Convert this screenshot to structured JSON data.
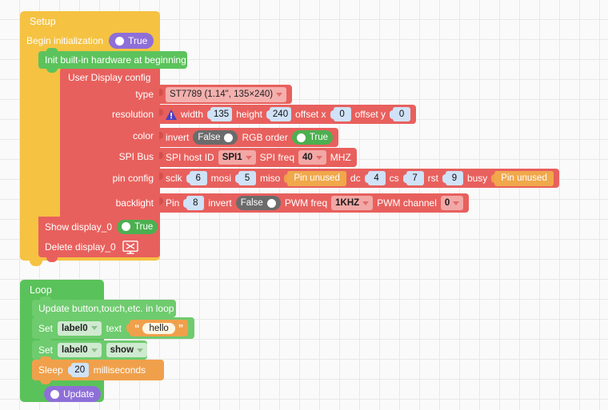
{
  "workspace": {
    "grid_size": 25,
    "background": "#fafafa",
    "grid_color": "#e8e8e8"
  },
  "colors": {
    "setup_hat": "#f5c242",
    "loop_hat": "#5ac25a",
    "statement_green": "#5cc35c",
    "config_red": "#e8605d",
    "value_orange": "#f0a04b",
    "boolean_purple": "#8e6fd8",
    "toggle_on": "#4caf50",
    "toggle_off": "#6b6b6b",
    "number_field": "#cfe2f7"
  },
  "setup": {
    "title": "Setup",
    "begin_init": {
      "label": "Begin initialization",
      "value": "True",
      "state": "on"
    },
    "init_hardware": {
      "label": "Init built-in hardware at beginning"
    },
    "display_config": {
      "title": "User Display config",
      "rows": [
        {
          "label": "type",
          "type_value": "ST7789 (1.14\", 135×240)"
        },
        {
          "label": "resolution",
          "warning": true,
          "width_label": "width",
          "width_value": "135",
          "height_label": "height",
          "height_value": "240",
          "offset_x_label": "offset x",
          "offset_x_value": "0",
          "offset_y_label": "offset y",
          "offset_y_value": "0"
        },
        {
          "label": "color",
          "invert_label": "invert",
          "invert_value": "False",
          "invert_state": "off",
          "rgb_label": "RGB order",
          "rgb_value": "True",
          "rgb_state": "on"
        },
        {
          "label": "SPI Bus",
          "host_label": "SPI host ID",
          "host_value": "SPI1",
          "freq_label": "SPI freq",
          "freq_value": "40",
          "freq_unit": "MHZ"
        },
        {
          "label": "pin config",
          "sclk_label": "sclk",
          "sclk_value": "6",
          "mosi_label": "mosi",
          "mosi_value": "5",
          "miso_label": "miso",
          "miso_value": "Pin unused",
          "dc_label": "dc",
          "dc_value": "4",
          "cs_label": "cs",
          "cs_value": "7",
          "rst_label": "rst",
          "rst_value": "9",
          "busy_label": "busy",
          "busy_value": "Pin unused"
        },
        {
          "label": "backlight",
          "pin_label": "Pin",
          "pin_value": "8",
          "invert_label": "invert",
          "invert_value": "False",
          "invert_state": "off",
          "pwm_freq_label": "PWM freq",
          "pwm_freq_value": "1KHZ",
          "pwm_channel_label": "PWM channel",
          "pwm_channel_value": "0"
        }
      ]
    },
    "show_display": {
      "label": "Show display_0",
      "value": "True",
      "state": "on"
    },
    "delete_display": {
      "label": "Delete display_0",
      "icon": "monitor-delete-icon"
    }
  },
  "loop": {
    "title": "Loop",
    "update_widgets": {
      "label": "Update button,touch,etc. in loop"
    },
    "set_text": {
      "set_label": "Set",
      "target": "label0",
      "property": "text",
      "string_value": "hello",
      "open_quote": "“",
      "close_quote": "”"
    },
    "set_show": {
      "set_label": "Set",
      "target": "label0",
      "property": "show"
    },
    "sleep": {
      "label": "Sleep",
      "value": "20",
      "unit": "milliseconds"
    },
    "update": {
      "label": "Update",
      "state": "on"
    }
  }
}
